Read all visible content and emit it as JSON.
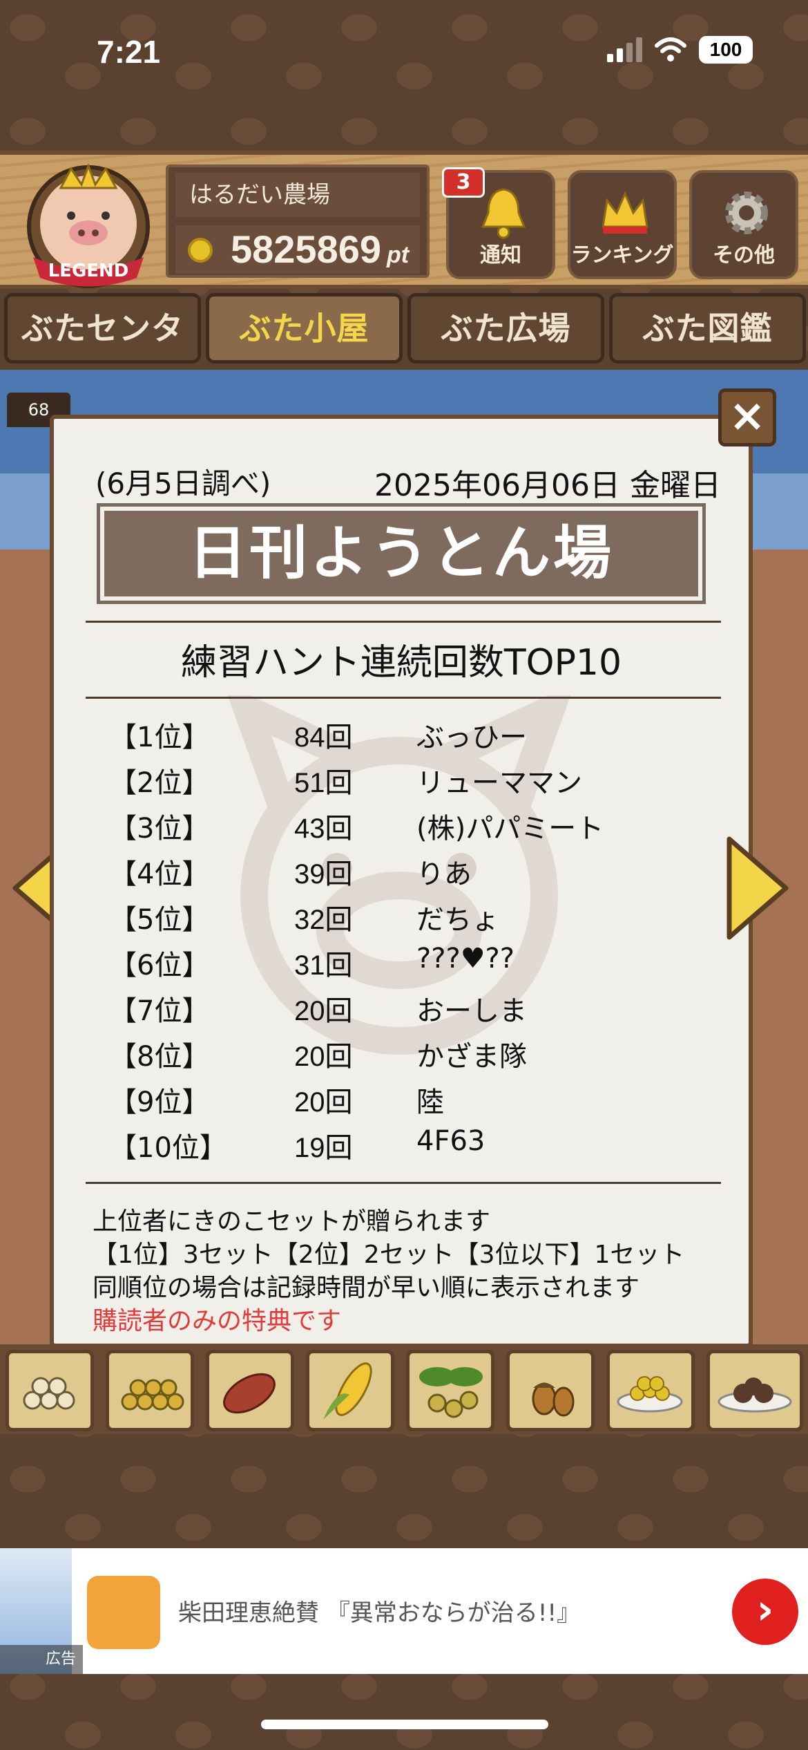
{
  "status": {
    "time": "7:21",
    "battery": "100"
  },
  "header": {
    "badge_text": "LEGEND",
    "farm_name": "はるだい農場",
    "points": "5825869",
    "points_unit": "pt",
    "buttons": [
      {
        "label": "通知",
        "icon": "bell-icon",
        "badge": "3"
      },
      {
        "label": "ランキング",
        "icon": "crown-icon"
      },
      {
        "label": "その他",
        "icon": "gear-icon"
      }
    ]
  },
  "tabs": [
    "ぶたセンター",
    "ぶた小屋",
    "ぶた広場",
    "ぶた図鑑"
  ],
  "level_tag": "68",
  "newspaper": {
    "date_note": "(6月5日調べ)",
    "date": "2025年06月06日 金曜日",
    "title": "日刊ようとん場",
    "subtitle": "練習ハント連続回数TOP10",
    "ranks": [
      {
        "pos": "【1位】",
        "count": "84回",
        "name": "ぶっひー"
      },
      {
        "pos": "【2位】",
        "count": "51回",
        "name": "リューママン"
      },
      {
        "pos": "【3位】",
        "count": "43回",
        "name": "(株)パパミート"
      },
      {
        "pos": "【4位】",
        "count": "39回",
        "name": "りあ"
      },
      {
        "pos": "【5位】",
        "count": "32回",
        "name": "だちょ"
      },
      {
        "pos": "【6位】",
        "count": "31回",
        "name": "???♥??"
      },
      {
        "pos": "【7位】",
        "count": "20回",
        "name": "おーしま"
      },
      {
        "pos": "【8位】",
        "count": "20回",
        "name": "かざま隊"
      },
      {
        "pos": "【9位】",
        "count": "20回",
        "name": "陸"
      },
      {
        "pos": "【10位】",
        "count": "19回",
        "name": "4F63"
      }
    ],
    "notes": [
      "上位者にきのこセットが贈られます",
      "【1位】3セット【2位】2セット【3位以下】1セット",
      "同順位の場合は記録時間が早い順に表示されます"
    ],
    "notice_red": "購読者のみの特典です",
    "close": "×"
  },
  "food_items": [
    "grains-icon",
    "beans-icon",
    "sweet-potato-icon",
    "corn-icon",
    "leaf-nuts-icon",
    "acorn-icon",
    "bowl-feed-icon",
    "meatball-plate-icon"
  ],
  "ad": {
    "text": "柴田理恵絶賛 『異常おならが治る!!』",
    "label": "広告",
    "go": "›"
  },
  "colors": {
    "accent": "#e53a3a",
    "brown": "#6a4a30",
    "title_bg": "#7f6b5d"
  }
}
